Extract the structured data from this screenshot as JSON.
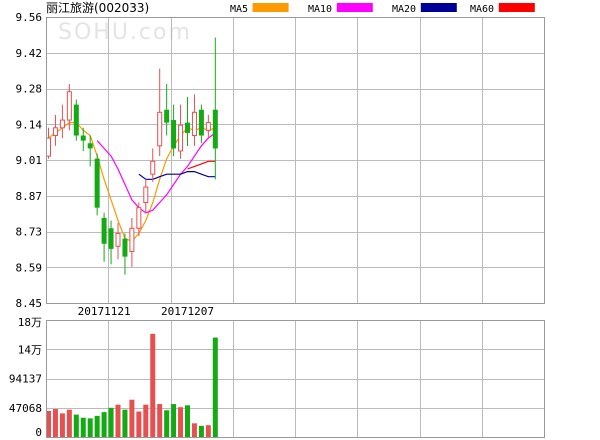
{
  "chart_data": {
    "type": "candlestick",
    "title": "丽江旅游(002033)",
    "watermark": "SOHU.com",
    "price_axis": {
      "ticks": [
        "9.56",
        "9.42",
        "9.28",
        "9.14",
        "9.01",
        "8.87",
        "8.73",
        "8.59",
        "8.45"
      ],
      "ylim": [
        8.45,
        9.56
      ]
    },
    "volume_axis": {
      "ticks": [
        "18万",
        "14万",
        "94137",
        "47068",
        "0"
      ],
      "ylim": [
        0,
        188274
      ]
    },
    "date_labels": [
      {
        "text": "20171121",
        "index": 8
      },
      {
        "text": "20171207",
        "index": 20
      }
    ],
    "legend": [
      {
        "name": "MA5",
        "color": "#ff9900"
      },
      {
        "name": "MA10",
        "color": "#ff00ff"
      },
      {
        "name": "MA20",
        "color": "#000099"
      },
      {
        "name": "MA60",
        "color": "#ff0000"
      }
    ],
    "colors": {
      "up": "#e65050",
      "down": "#14aa14",
      "grid": "#bbbbbb"
    },
    "candles": [
      {
        "o": 9.02,
        "c": 9.09,
        "h": 9.13,
        "l": 9.01
      },
      {
        "o": 9.1,
        "c": 9.13,
        "h": 9.18,
        "l": 9.06
      },
      {
        "o": 9.13,
        "c": 9.16,
        "h": 9.22,
        "l": 9.09
      },
      {
        "o": 9.16,
        "c": 9.27,
        "h": 9.3,
        "l": 9.12
      },
      {
        "o": 9.22,
        "c": 9.1,
        "h": 9.24,
        "l": 9.08
      },
      {
        "o": 9.1,
        "c": 9.08,
        "h": 9.13,
        "l": 9.04
      },
      {
        "o": 9.07,
        "c": 9.05,
        "h": 9.1,
        "l": 8.98
      },
      {
        "o": 9.01,
        "c": 8.82,
        "h": 9.03,
        "l": 8.79
      },
      {
        "o": 8.78,
        "c": 8.68,
        "h": 8.8,
        "l": 8.61
      },
      {
        "o": 8.74,
        "c": 8.66,
        "h": 8.77,
        "l": 8.6
      },
      {
        "o": 8.67,
        "c": 8.72,
        "h": 8.76,
        "l": 8.62
      },
      {
        "o": 8.7,
        "c": 8.63,
        "h": 8.72,
        "l": 8.56
      },
      {
        "o": 8.65,
        "c": 8.74,
        "h": 8.78,
        "l": 8.59
      },
      {
        "o": 8.74,
        "c": 8.82,
        "h": 8.84,
        "l": 8.71
      },
      {
        "o": 8.84,
        "c": 8.9,
        "h": 8.93,
        "l": 8.8
      },
      {
        "o": 8.95,
        "c": 9.0,
        "h": 9.05,
        "l": 8.92
      },
      {
        "o": 9.06,
        "c": 9.19,
        "h": 9.36,
        "l": 9.02
      },
      {
        "o": 9.2,
        "c": 9.15,
        "h": 9.3,
        "l": 9.1
      },
      {
        "o": 9.16,
        "c": 9.05,
        "h": 9.22,
        "l": 9.02
      },
      {
        "o": 9.04,
        "c": 9.14,
        "h": 9.22,
        "l": 9.01
      },
      {
        "o": 9.15,
        "c": 9.11,
        "h": 9.25,
        "l": 9.06
      },
      {
        "o": 9.1,
        "c": 9.19,
        "h": 9.26,
        "l": 9.06
      },
      {
        "o": 9.2,
        "c": 9.1,
        "h": 9.22,
        "l": 9.07
      },
      {
        "o": 9.12,
        "c": 9.15,
        "h": 9.18,
        "l": 9.09
      },
      {
        "o": 9.2,
        "c": 9.05,
        "h": 9.48,
        "l": 8.93
      }
    ],
    "volumes": [
      42000,
      45000,
      38000,
      44000,
      36000,
      31000,
      30000,
      34000,
      40000,
      47000,
      52000,
      44000,
      60000,
      41000,
      52000,
      166000,
      53000,
      43000,
      53000,
      48000,
      51000,
      22000,
      18000,
      19000,
      160000
    ],
    "moving_averages": {
      "MA5": [
        9.09,
        9.11,
        9.13,
        9.15,
        9.15,
        9.12,
        9.1,
        9.02,
        8.93,
        8.85,
        8.77,
        8.7,
        8.69,
        8.72,
        8.77,
        8.84,
        8.93,
        9.01,
        9.06,
        9.1,
        9.13,
        9.12,
        9.13,
        9.12,
        9.13
      ],
      "MA10": [
        null,
        null,
        null,
        null,
        null,
        null,
        null,
        9.08,
        9.05,
        9.02,
        8.97,
        8.91,
        8.85,
        8.82,
        8.8,
        8.81,
        8.84,
        8.87,
        8.91,
        8.95,
        8.98,
        9.02,
        9.06,
        9.09,
        9.11
      ],
      "MA20": [
        null,
        null,
        null,
        null,
        null,
        null,
        null,
        null,
        null,
        null,
        null,
        null,
        null,
        8.95,
        8.93,
        8.93,
        8.94,
        8.95,
        8.95,
        8.95,
        8.96,
        8.96,
        8.95,
        8.94,
        8.94
      ],
      "MA60": [
        null,
        null,
        null,
        null,
        null,
        null,
        null,
        null,
        null,
        null,
        null,
        null,
        null,
        null,
        null,
        null,
        null,
        null,
        null,
        null,
        8.97,
        8.98,
        8.99,
        9.0,
        9.0
      ]
    }
  }
}
